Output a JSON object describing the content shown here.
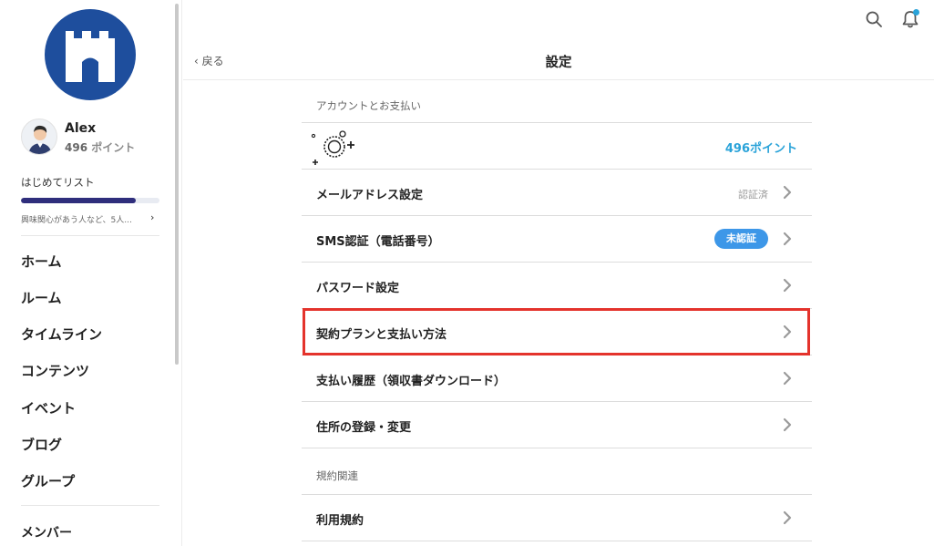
{
  "sidebar": {
    "user": {
      "name": "Alex",
      "points_number": "496",
      "points_unit": "ポイント"
    },
    "beginner": {
      "title": "はじめてリスト",
      "description": "興味関心があう人など、5人...",
      "progress": 0.83
    },
    "nav": [
      "ホーム",
      "ルーム",
      "タイムライン",
      "コンテンツ",
      "イベント",
      "ブログ",
      "グループ",
      "メンバー"
    ]
  },
  "header": {
    "back_label": "戻る",
    "title": "設定"
  },
  "settings": {
    "section_account": "アカウントとお支払い",
    "points": "496ポイント",
    "rows": [
      {
        "label": "メールアドレス設定",
        "status": "認証済"
      },
      {
        "label": "SMS認証（電話番号）",
        "badge": "未認証"
      },
      {
        "label": "パスワード設定"
      },
      {
        "label": "契約プランと支払い方法"
      },
      {
        "label": "支払い履歴（領収書ダウンロード）"
      },
      {
        "label": "住所の登録・変更"
      }
    ],
    "section_terms": "規約関連",
    "terms_rows": [
      {
        "label": "利用規約"
      }
    ]
  },
  "colors": {
    "logo": "#1e4e9d",
    "accent": "#2aa3d9",
    "badge": "#3d97e8",
    "highlight": "#e4332c",
    "progress": "#2f2e7c"
  }
}
